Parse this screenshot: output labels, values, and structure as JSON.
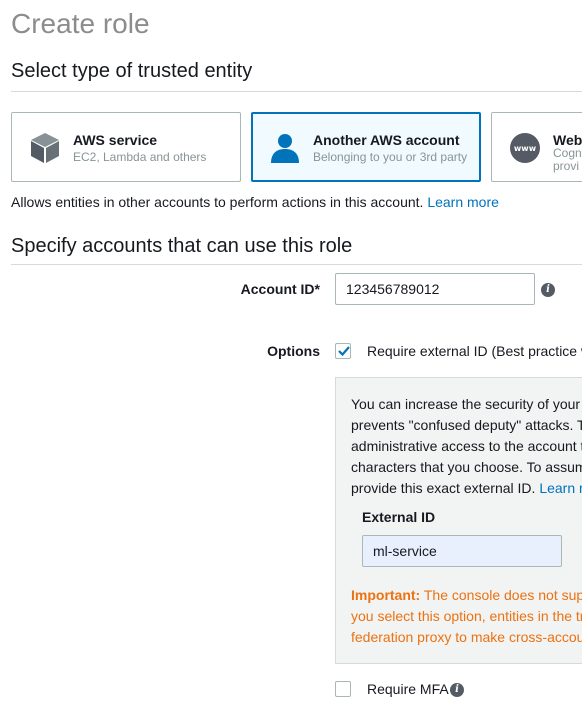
{
  "page": {
    "title": "Create role"
  },
  "trusted_entity": {
    "heading": "Select type of trusted entity",
    "cards": [
      {
        "title": "AWS service",
        "subtitle": "EC2, Lambda and others",
        "icon": "cube-icon",
        "selected": false
      },
      {
        "title": "Another AWS account",
        "subtitle": "Belonging to you or 3rd party",
        "icon": "person-icon",
        "selected": true
      },
      {
        "title": "Web",
        "subtitle_line1": "Cogn",
        "subtitle_line2": "provi",
        "icon": "www-icon",
        "selected": false
      }
    ],
    "description": "Allows entities in other accounts to perform actions in this account.",
    "learn_more": "Learn more"
  },
  "accounts": {
    "heading": "Specify accounts that can use this role",
    "account_id_label": "Account ID*",
    "account_id_value": "123456789012",
    "options_label": "Options",
    "require_external_id": {
      "label": "Require external ID (Best practice w",
      "checked": true
    },
    "external_panel": {
      "line1": "You can increase the security of your",
      "line2": "prevents \"confused deputy\" attacks. T",
      "line3": "administrative access to the account t",
      "line4": "characters that you choose. To assum",
      "line5_text": "provide this exact external ID. ",
      "line5_link": "Learn r",
      "external_id_label": "External ID",
      "external_id_value": "ml-service",
      "important_label": "Important:",
      "warn_line1": " The console does not sup",
      "warn_line2": "you select this option, entities in the tr",
      "warn_line3": "federation proxy to make cross-accou"
    },
    "require_mfa": {
      "label": "Require MFA",
      "checked": false
    }
  },
  "colors": {
    "accent": "#0073bb",
    "selected_bg": "#f1faff",
    "warning": "#ec7211",
    "muted_title": "#8c8c8c"
  }
}
